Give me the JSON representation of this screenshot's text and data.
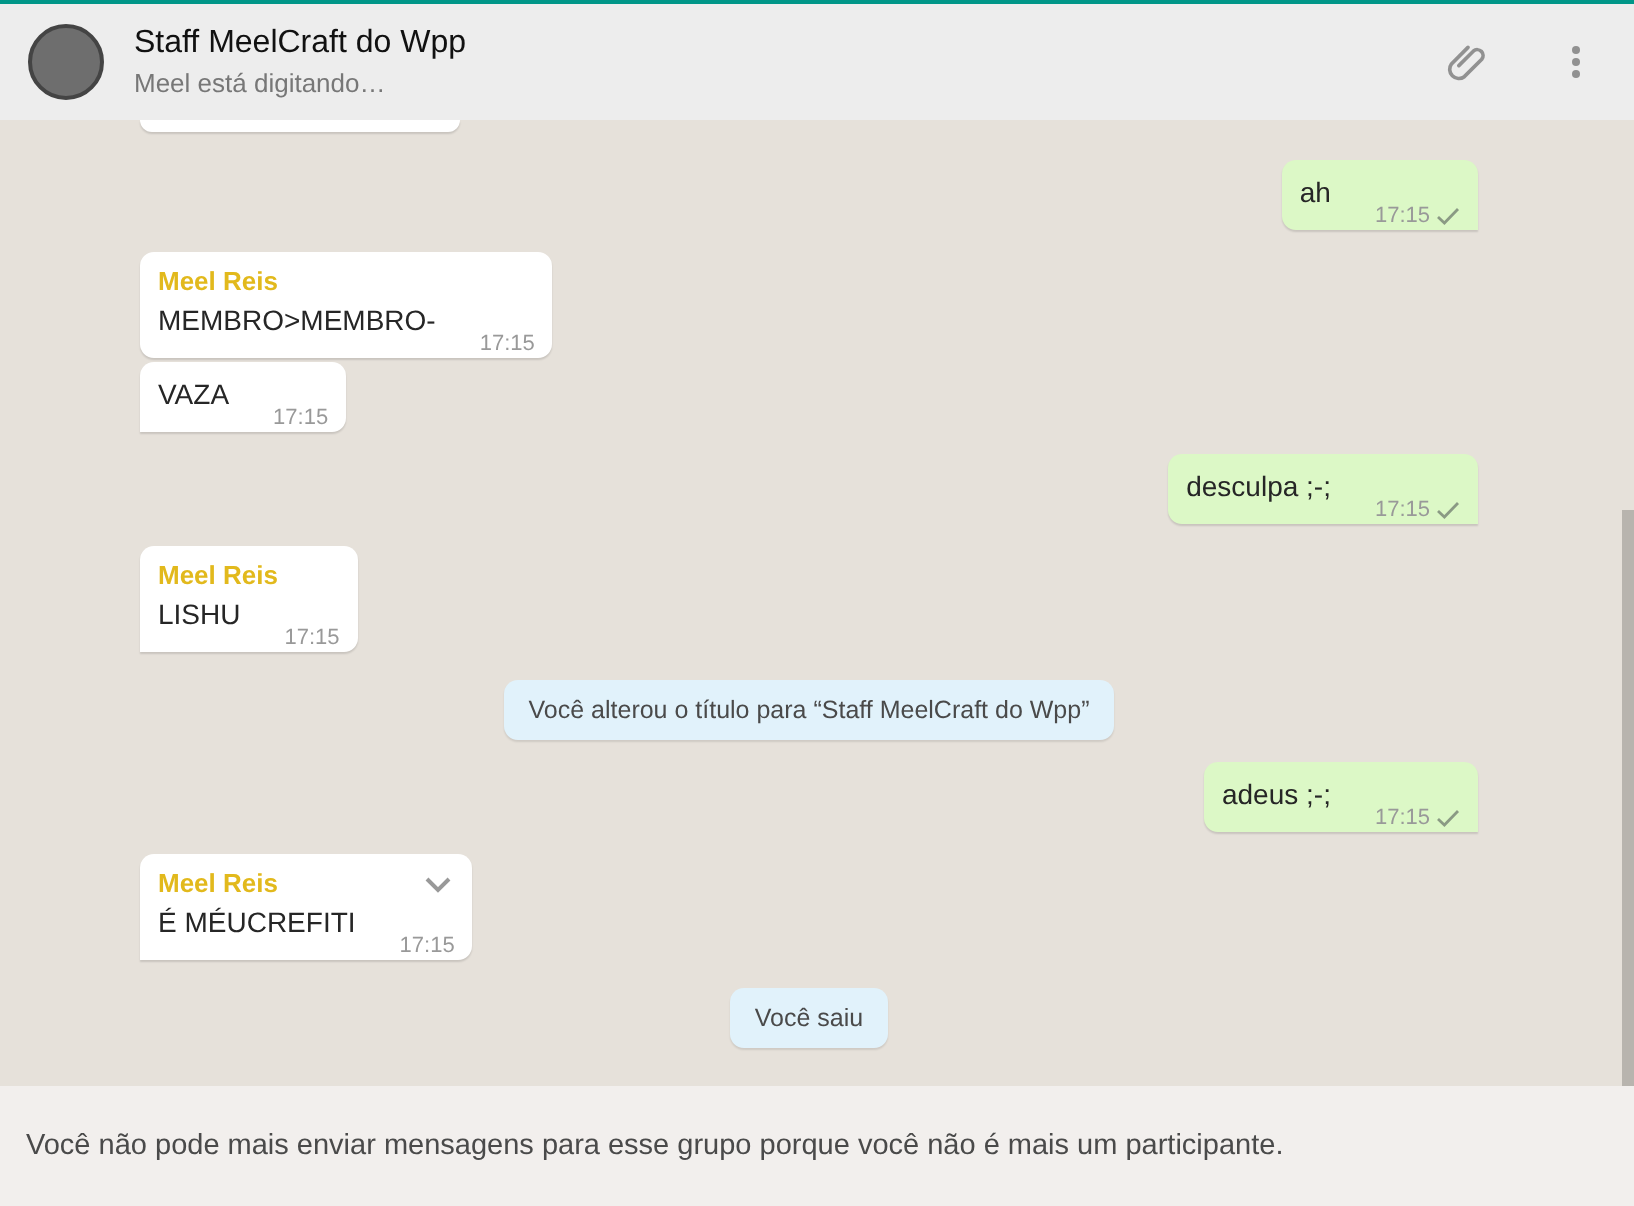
{
  "header": {
    "title": "Staff MeelCraft do Wpp",
    "subtitle": "Meel está digitando…"
  },
  "messages": [
    {
      "kind": "outgoing",
      "text": "ah",
      "time": "17:15",
      "tail": true
    },
    {
      "kind": "incoming",
      "sender": "Meel Reis",
      "text": "MEMBRO>MEMBRO-",
      "time": "17:15",
      "tail": false
    },
    {
      "kind": "incoming",
      "text": "VAZA",
      "time": "17:15",
      "tail": true
    },
    {
      "kind": "outgoing",
      "text": "desculpa ;-;",
      "time": "17:15",
      "tail": true
    },
    {
      "kind": "incoming",
      "sender": "Meel Reis",
      "text": "LISHU",
      "time": "17:15",
      "tail": true
    },
    {
      "kind": "system",
      "text": "Você alterou o título para “Staff MeelCraft do Wpp”"
    },
    {
      "kind": "outgoing",
      "text": "adeus ;-;",
      "time": "17:15",
      "tail": true
    },
    {
      "kind": "incoming",
      "sender": "Meel Reis",
      "text": "É MÉUCREFITI",
      "time": "17:15",
      "tail": true,
      "menu": true
    },
    {
      "kind": "system",
      "text": "Você saiu"
    }
  ],
  "footer": {
    "notice": "Você não pode mais enviar mensagens para esse grupo porque você não é mais um participante."
  }
}
